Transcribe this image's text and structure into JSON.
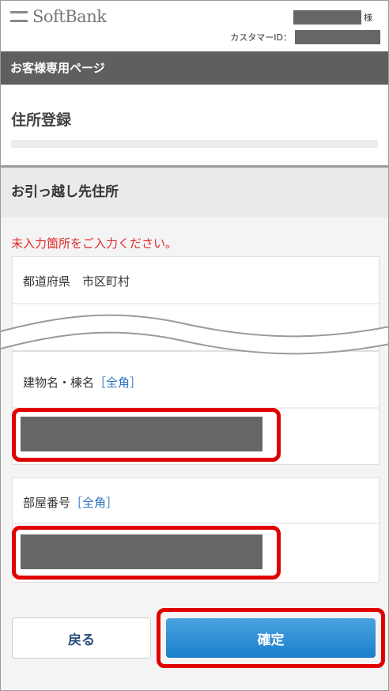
{
  "header": {
    "brand": "SoftBank",
    "user_suffix": "様",
    "customer_id_label": "カスタマーID："
  },
  "title_bar": "お客様専用ページ",
  "page_title": "住所登録",
  "section": {
    "title": "お引っ越し先住所",
    "error_message": "未入力箇所をご入力ください。"
  },
  "fields": {
    "prefecture_label": "都道府県　市区町村",
    "building_label": "建物名・棟名",
    "building_tag": "［全角］",
    "room_label": "部屋番号",
    "room_tag": "［全角］"
  },
  "buttons": {
    "back": "戻る",
    "confirm": "確定"
  },
  "colors": {
    "header_bar": "#5f5f5f",
    "error_text": "#e02a2a",
    "highlight": "#e00000",
    "primary_button": "#1b7fcc",
    "tag_text": "#2f74c0"
  }
}
